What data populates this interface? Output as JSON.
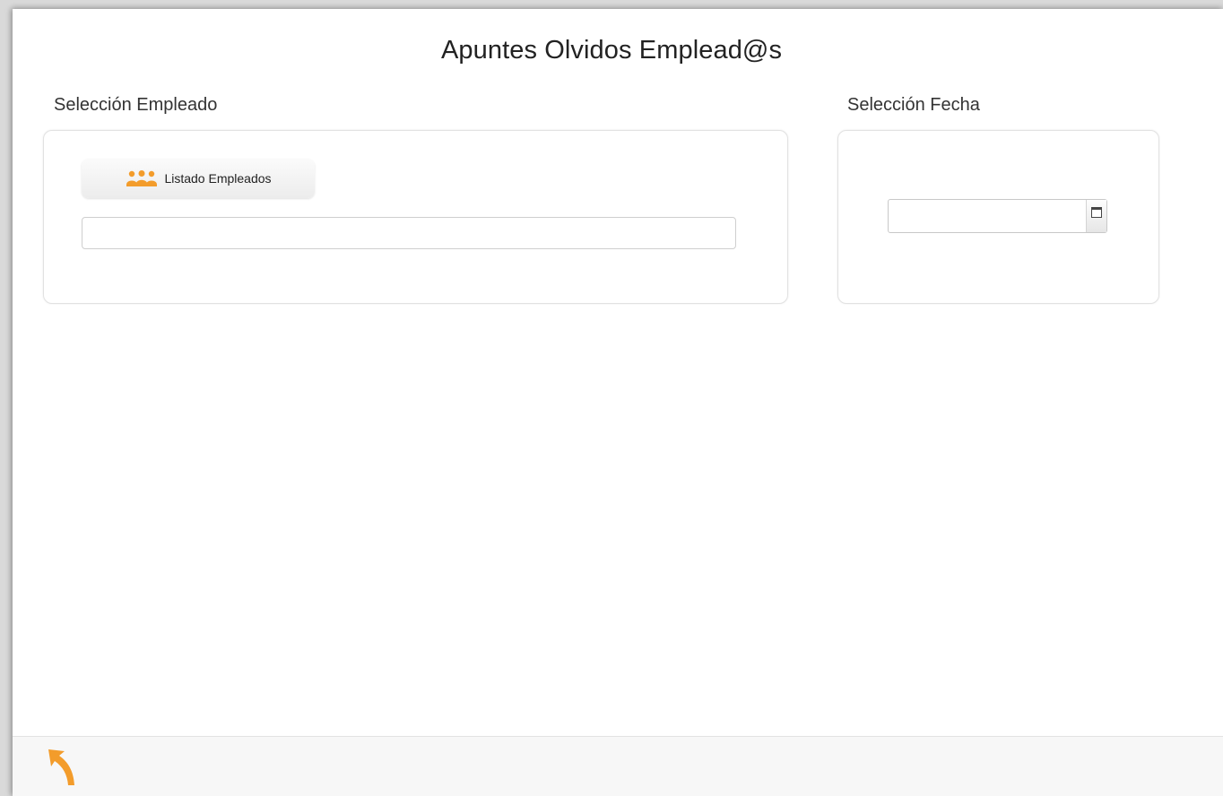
{
  "page": {
    "title": "Apuntes Olvidos Emplead@s"
  },
  "employee_section": {
    "label": "Selección Empleado",
    "list_button_label": "Listado Empleados",
    "list_button_icon": "people-icon",
    "employee_value": ""
  },
  "date_section": {
    "label": "Selección Fecha",
    "date_value": "",
    "calendar_icon": "calendar-icon"
  },
  "footer": {
    "back_icon": "back-arrow-icon"
  },
  "colors": {
    "accent": "#f39c2b",
    "background": "#ffffff",
    "footer_background": "#f7f7f7"
  }
}
